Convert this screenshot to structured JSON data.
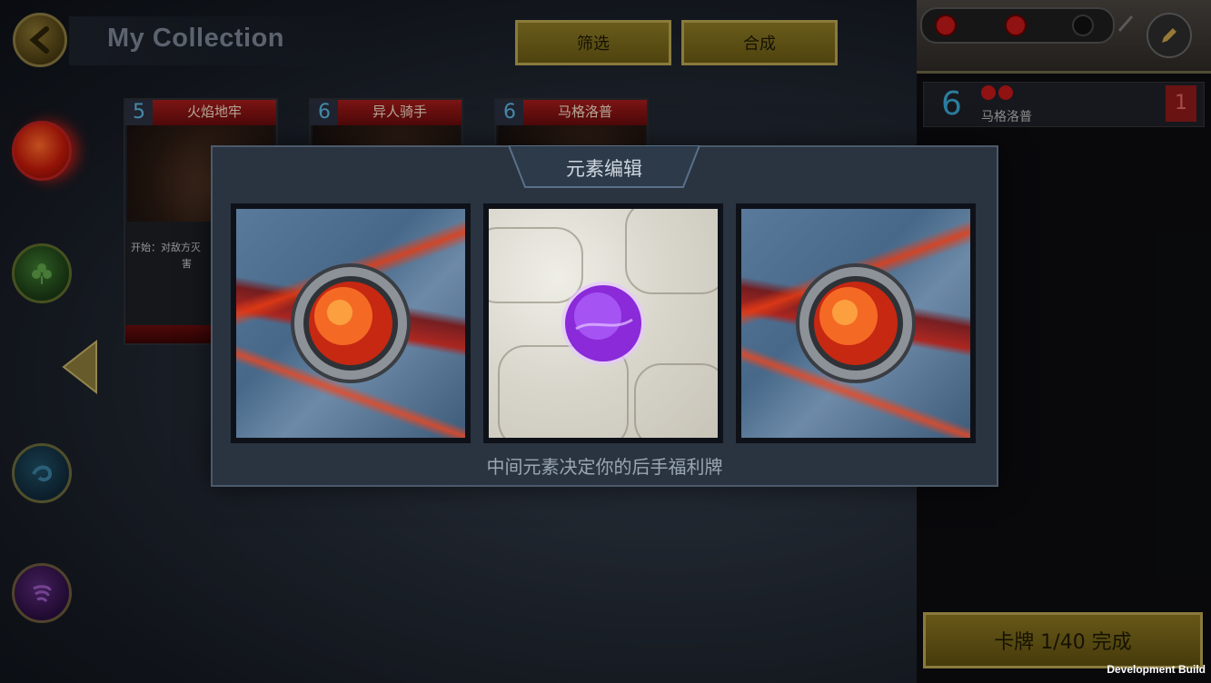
{
  "header": {
    "title": "My Collection",
    "filter_label": "筛选",
    "craft_label": "合成"
  },
  "cards": [
    {
      "cost": "5",
      "name": "火焰地牢",
      "text_line1": "开始：对敌方灭",
      "text_line2": "害"
    },
    {
      "cost": "6",
      "name": "异人骑手"
    },
    {
      "cost": "6",
      "name": "马格洛普"
    }
  ],
  "deck": {
    "entry": {
      "cost": "6",
      "name": "马格洛普",
      "count": "1"
    },
    "complete_label": "卡牌  1/40  完成"
  },
  "modal": {
    "title": "元素编辑",
    "hint": "中间元素决定你的后手福利牌",
    "slots": [
      {
        "element": "fire",
        "background": "lava"
      },
      {
        "element": "void",
        "background": "stone"
      },
      {
        "element": "fire",
        "background": "lava"
      }
    ]
  },
  "footer": {
    "build_label": "Development Build"
  },
  "colors": {
    "gold": "#b9a452",
    "fire": "#e0301a",
    "void": "#9a40e0",
    "accent_blue": "#3aa7d5"
  }
}
